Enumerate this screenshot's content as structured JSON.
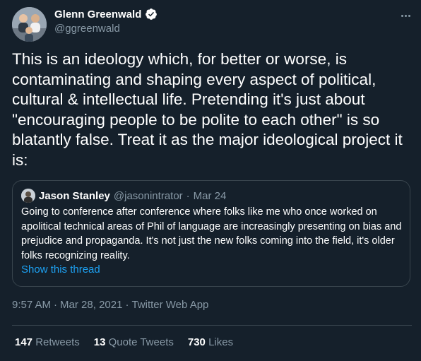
{
  "author": {
    "name": "Glenn Greenwald",
    "handle": "@ggreenwald",
    "verified_color": "#1da1f2"
  },
  "tweet": {
    "text": "This is an ideology which, for better or worse, is contaminating and shaping every aspect of political, cultural & intellectual life. Pretending it's just about \"encouraging people to be polite to each other\" is so blatantly false. Treat it as the major ideological project it is:"
  },
  "quote": {
    "name": "Jason Stanley",
    "handle": "@jasonintrator",
    "separator": "·",
    "date": "Mar 24",
    "text": "Going to conference after conference where folks like me who once worked on apolitical technical areas of Phil of language are increasingly presenting on bias and prejudice and propaganda. It's not just the new folks coming into the field, it's older folks recognizing reality.",
    "show_thread": "Show this thread"
  },
  "meta": {
    "time": "9:57 AM",
    "sep1": "·",
    "date": "Mar 28, 2021",
    "sep2": "·",
    "source": "Twitter Web App"
  },
  "stats": {
    "retweets_count": "147",
    "retweets_label": "Retweets",
    "quotes_count": "13",
    "quotes_label": "Quote Tweets",
    "likes_count": "730",
    "likes_label": "Likes"
  },
  "colors": {
    "background": "#15202b",
    "link": "#1da1f2",
    "secondary_text": "#8899a6",
    "border": "#38444d"
  }
}
